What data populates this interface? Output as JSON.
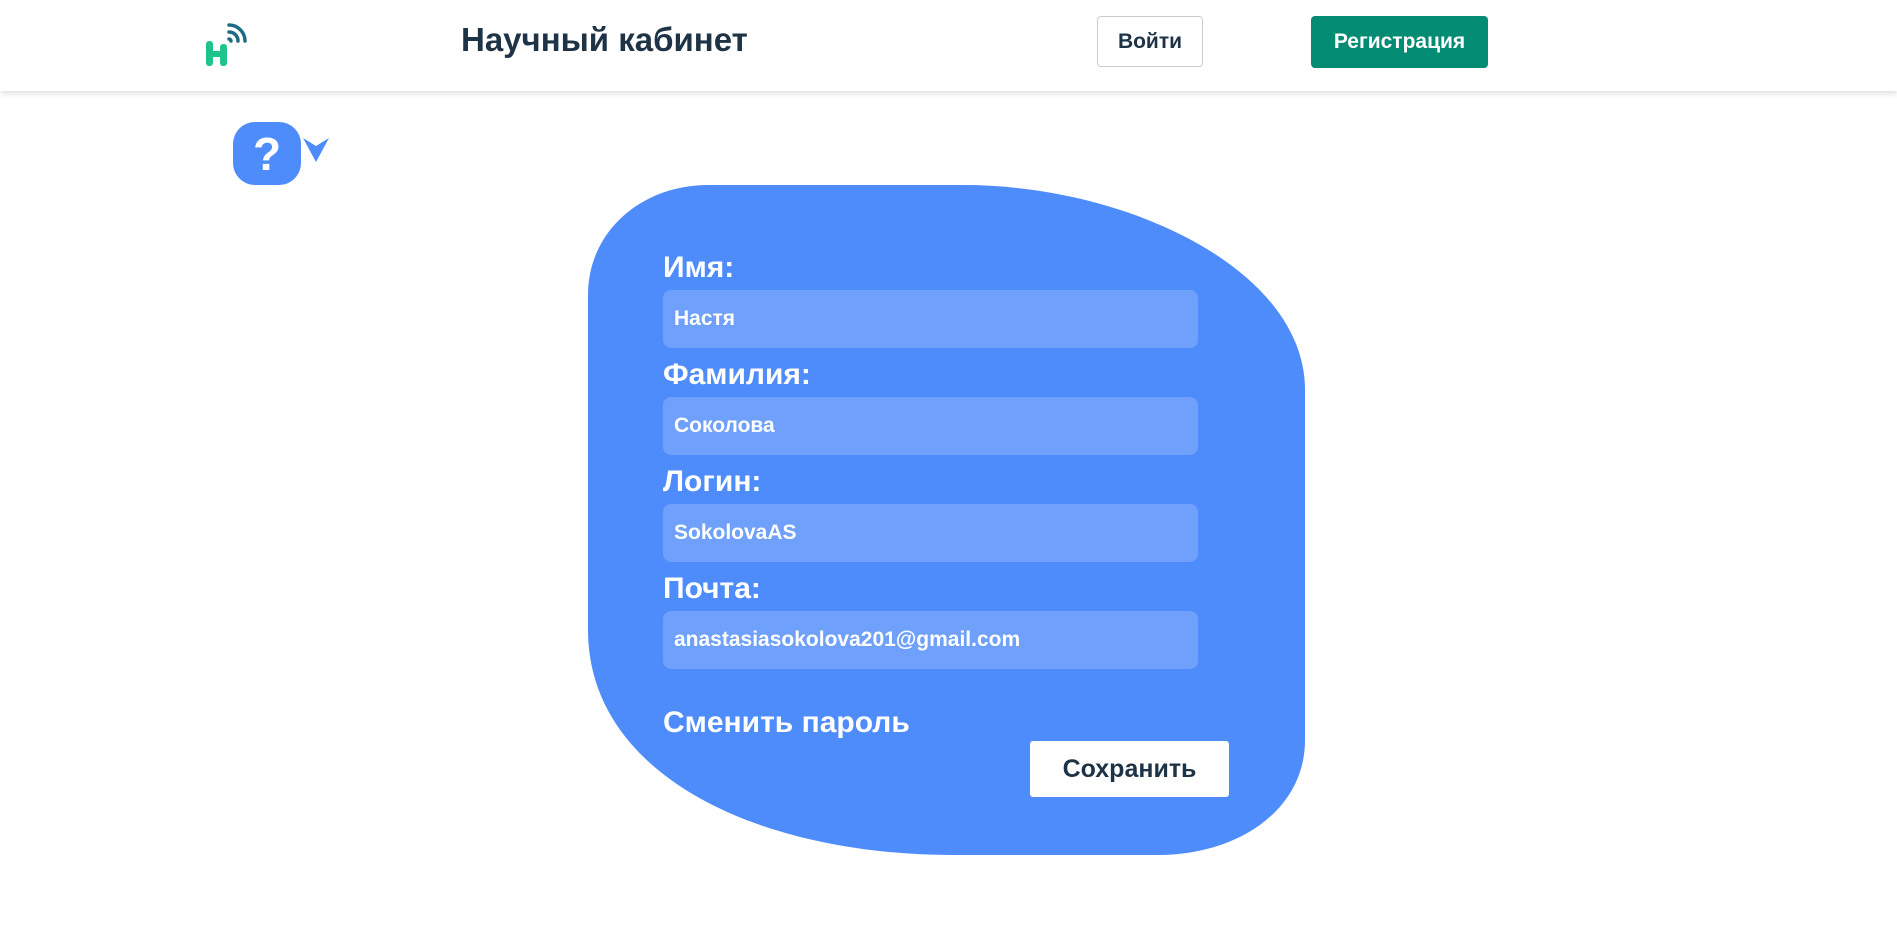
{
  "header": {
    "title": "Научный кабинет",
    "login_label": "Войти",
    "register_label": "Регистрация",
    "logo_icon": "h-signal-logo-icon"
  },
  "help": {
    "icon_text": "?",
    "arrow_icon": "chevron-down-icon"
  },
  "profile_form": {
    "fields": [
      {
        "label": "Имя:",
        "value": "Настя"
      },
      {
        "label": "Фамилия:",
        "value": "Соколова"
      },
      {
        "label": "Логин:",
        "value": "SokolovaAS"
      },
      {
        "label": "Почта:",
        "value": "anastasiasokolova201@gmail.com"
      }
    ],
    "change_password_label": "Сменить пароль",
    "save_label": "Сохранить"
  },
  "colors": {
    "accent": "#4f8cfb",
    "input_bg": "#6ea0fc",
    "brand_green": "#048b74",
    "text_dark": "#1f3347"
  }
}
